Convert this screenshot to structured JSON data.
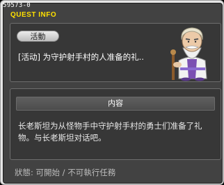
{
  "window": {
    "quest_id": "59573-0",
    "title": "QUEST INFO"
  },
  "quest": {
    "category": "活動",
    "name": "[活动] 为守护射手村的人准备的礼..",
    "npc_portrait": "old-wizard-npc-portrait"
  },
  "content": {
    "header": "内容",
    "description": "长老斯坦为从怪物手中守护射手村的勇士们准备了礼物。与长老斯坦对话吧。"
  },
  "status": {
    "text": "狀態: 可開始 / 不可執行任務"
  },
  "colors": {
    "title": "#ffe000",
    "frame": "#424242",
    "panel": "#373737",
    "outer": "#e7e7e7"
  }
}
